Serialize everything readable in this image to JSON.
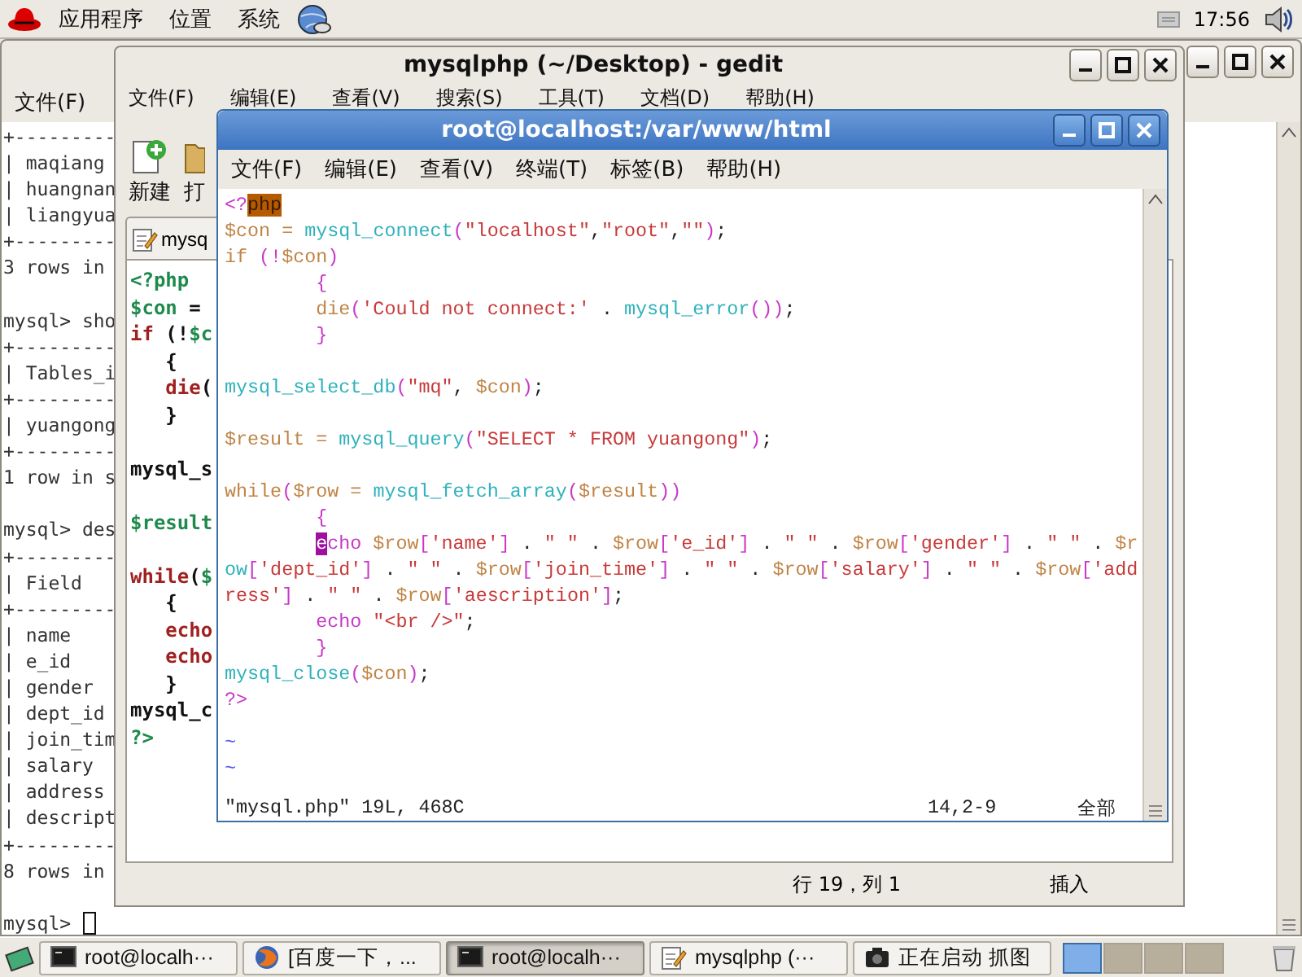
{
  "top_panel": {
    "menus": [
      "应用程序",
      "位置",
      "系统"
    ],
    "clock": "17:56"
  },
  "back_terminal": {
    "menus": [
      "文件(F)"
    ],
    "blocks": [
      [
        "+---------",
        "| maqiang",
        "| huangnan",
        "| liangyua",
        "+---------",
        "3 rows in"
      ],
      [
        "mysql> sho",
        "+---------",
        "| Tables_i",
        "+---------",
        "| yuangong",
        "+---------",
        "1 row in s"
      ],
      [
        "mysql> des",
        "+---------",
        "| Field",
        "+---------",
        "| name",
        "| e_id",
        "| gender",
        "| dept_id",
        "| join_tim",
        "| salary",
        "| address",
        "| descript",
        "+---------",
        "8 rows in"
      ]
    ],
    "prompt": "mysql>"
  },
  "gedit": {
    "title": "mysqlphp (~/Desktop) - gedit",
    "menus": [
      "文件(F)",
      "编辑(E)",
      "查看(V)",
      "搜索(S)",
      "工具(T)",
      "文档(D)",
      "帮助(H)"
    ],
    "toolbar": [
      {
        "kind": "new",
        "label": "新建"
      },
      {
        "kind": "open",
        "label": "打"
      }
    ],
    "tab": "mysq",
    "blocks": [
      [
        [
          {
            "kind": "variable",
            "text": "<?php"
          }
        ],
        [
          {
            "kind": "variable",
            "text": "$con"
          },
          {
            "kind": "text",
            "text": " ="
          }
        ],
        [
          {
            "kind": "keyword",
            "text": "if"
          },
          {
            "kind": "text",
            "text": " (!"
          },
          {
            "kind": "variable",
            "text": "$c"
          }
        ],
        [
          {
            "kind": "text",
            "text": "   {"
          }
        ],
        [
          {
            "kind": "keyword",
            "text": "   die"
          },
          {
            "kind": "text",
            "text": "("
          }
        ],
        [
          {
            "kind": "text",
            "text": "   }"
          }
        ]
      ],
      [
        [
          {
            "kind": "text",
            "text": "mysql_s"
          }
        ]
      ],
      [
        [
          {
            "kind": "variable",
            "text": "$result"
          }
        ]
      ],
      [
        [
          {
            "kind": "keyword",
            "text": "while"
          },
          {
            "kind": "text",
            "text": "("
          },
          {
            "kind": "variable",
            "text": "$"
          }
        ],
        [
          {
            "kind": "text",
            "text": "   {"
          }
        ],
        [
          {
            "kind": "keyword",
            "text": "   echo"
          }
        ],
        [
          {
            "kind": "keyword",
            "text": "   echo"
          }
        ],
        [
          {
            "kind": "text",
            "text": "   }"
          }
        ],
        [
          {
            "kind": "text",
            "text": "mysql_c"
          }
        ],
        [
          {
            "kind": "variable",
            "text": "?>"
          }
        ]
      ]
    ],
    "status": {
      "position": "行 19，列 1",
      "mode": "插入"
    }
  },
  "front_terminal": {
    "title": "root@localhost:/var/www/html",
    "menus": [
      "文件(F)",
      "编辑(E)",
      "查看(V)",
      "终端(T)",
      "标签(B)",
      "帮助(H)"
    ],
    "blocks": [
      [
        [
          {
            "kind": "tag",
            "text": "<?"
          },
          {
            "kind": "match",
            "text": "php"
          }
        ],
        [
          {
            "kind": "variable",
            "text": "$con = "
          },
          {
            "kind": "function",
            "text": "mysql_connect"
          },
          {
            "kind": "tag",
            "text": "("
          },
          {
            "kind": "string",
            "text": "\"localhost\""
          },
          {
            "kind": "text",
            "text": ","
          },
          {
            "kind": "string",
            "text": "\"root\""
          },
          {
            "kind": "text",
            "text": ","
          },
          {
            "kind": "string",
            "text": "\"\""
          },
          {
            "kind": "tag",
            "text": ")"
          },
          {
            "kind": "text",
            "text": ";"
          }
        ],
        [
          {
            "kind": "variable",
            "text": "if "
          },
          {
            "kind": "tag",
            "text": "(!"
          },
          {
            "kind": "variable",
            "text": "$con"
          },
          {
            "kind": "tag",
            "text": ")"
          }
        ],
        [
          {
            "kind": "tag",
            "text": "        {"
          }
        ],
        [
          {
            "kind": "variable",
            "text": "        die"
          },
          {
            "kind": "tag",
            "text": "("
          },
          {
            "kind": "string",
            "text": "'Could not connect:'"
          },
          {
            "kind": "text",
            "text": " . "
          },
          {
            "kind": "function",
            "text": "mysql_error"
          },
          {
            "kind": "tag",
            "text": "())"
          },
          {
            "kind": "text",
            "text": ";"
          }
        ],
        [
          {
            "kind": "tag",
            "text": "        }"
          }
        ]
      ],
      [
        [
          {
            "kind": "function",
            "text": "mysql_select_db"
          },
          {
            "kind": "tag",
            "text": "("
          },
          {
            "kind": "string",
            "text": "\"mq\""
          },
          {
            "kind": "text",
            "text": ", "
          },
          {
            "kind": "variable",
            "text": "$con"
          },
          {
            "kind": "tag",
            "text": ")"
          },
          {
            "kind": "text",
            "text": ";"
          }
        ]
      ],
      [
        [
          {
            "kind": "variable",
            "text": "$result = "
          },
          {
            "kind": "function",
            "text": "mysql_query"
          },
          {
            "kind": "tag",
            "text": "("
          },
          {
            "kind": "string",
            "text": "\"SELECT * FROM yuangong\""
          },
          {
            "kind": "tag",
            "text": ")"
          },
          {
            "kind": "text",
            "text": ";"
          }
        ]
      ],
      [
        [
          {
            "kind": "variable",
            "text": "while"
          },
          {
            "kind": "tag",
            "text": "("
          },
          {
            "kind": "variable",
            "text": "$row = "
          },
          {
            "kind": "function",
            "text": "mysql_fetch_array"
          },
          {
            "kind": "tag",
            "text": "("
          },
          {
            "kind": "variable",
            "text": "$result"
          },
          {
            "kind": "tag",
            "text": "))"
          }
        ],
        [
          {
            "kind": "tag",
            "text": "        {"
          }
        ],
        [
          {
            "kind": "cursor",
            "text": "e",
            "indent": true
          },
          {
            "kind": "tag",
            "text": "cho"
          },
          {
            "kind": "variable",
            "text": " $row"
          },
          {
            "kind": "tag",
            "text": "["
          },
          {
            "kind": "string",
            "text": "'name'"
          },
          {
            "kind": "tag",
            "text": "]"
          },
          {
            "kind": "text",
            "text": " . "
          },
          {
            "kind": "string",
            "text": "\" \""
          },
          {
            "kind": "text",
            "text": " . "
          },
          {
            "kind": "variable",
            "text": "$row"
          },
          {
            "kind": "tag",
            "text": "["
          },
          {
            "kind": "string",
            "text": "'e_id'"
          },
          {
            "kind": "tag",
            "text": "]"
          },
          {
            "kind": "text",
            "text": " . "
          },
          {
            "kind": "string",
            "text": "\" \""
          },
          {
            "kind": "text",
            "text": " . "
          },
          {
            "kind": "variable",
            "text": "$row"
          },
          {
            "kind": "tag",
            "text": "["
          },
          {
            "kind": "string",
            "text": "'gender'"
          },
          {
            "kind": "tag",
            "text": "]"
          },
          {
            "kind": "text",
            "text": " . "
          },
          {
            "kind": "string",
            "text": "\" \""
          },
          {
            "kind": "text",
            "text": " . "
          },
          {
            "kind": "variable",
            "text": "$r"
          }
        ],
        [
          {
            "kind": "function",
            "text": "ow"
          },
          {
            "kind": "tag",
            "text": "["
          },
          {
            "kind": "string",
            "text": "'dept_id'"
          },
          {
            "kind": "tag",
            "text": "]"
          },
          {
            "kind": "text",
            "text": " . "
          },
          {
            "kind": "string",
            "text": "\" \""
          },
          {
            "kind": "text",
            "text": " . "
          },
          {
            "kind": "variable",
            "text": "$row"
          },
          {
            "kind": "tag",
            "text": "["
          },
          {
            "kind": "string",
            "text": "'join_time'"
          },
          {
            "kind": "tag",
            "text": "]"
          },
          {
            "kind": "text",
            "text": " . "
          },
          {
            "kind": "string",
            "text": "\" \""
          },
          {
            "kind": "text",
            "text": " . "
          },
          {
            "kind": "variable",
            "text": "$row"
          },
          {
            "kind": "tag",
            "text": "["
          },
          {
            "kind": "string",
            "text": "'salary'"
          },
          {
            "kind": "tag",
            "text": "]"
          },
          {
            "kind": "text",
            "text": " . "
          },
          {
            "kind": "string",
            "text": "\" \""
          },
          {
            "kind": "text",
            "text": " . "
          },
          {
            "kind": "variable",
            "text": "$row"
          },
          {
            "kind": "tag",
            "text": "["
          },
          {
            "kind": "string",
            "text": "'add"
          }
        ],
        [
          {
            "kind": "string",
            "text": "ress'"
          },
          {
            "kind": "tag",
            "text": "]"
          },
          {
            "kind": "text",
            "text": " . "
          },
          {
            "kind": "string",
            "text": "\" \""
          },
          {
            "kind": "text",
            "text": " . "
          },
          {
            "kind": "variable",
            "text": "$row"
          },
          {
            "kind": "tag",
            "text": "["
          },
          {
            "kind": "string",
            "text": "'aescription'"
          },
          {
            "kind": "tag",
            "text": "]"
          },
          {
            "kind": "text",
            "text": ";"
          }
        ],
        [
          {
            "kind": "tag",
            "text": "        echo"
          },
          {
            "kind": "string",
            "text": " \"<br />\""
          },
          {
            "kind": "text",
            "text": ";"
          }
        ],
        [
          {
            "kind": "tag",
            "text": "        }"
          }
        ],
        [
          {
            "kind": "function",
            "text": "mysql_close"
          },
          {
            "kind": "tag",
            "text": "("
          },
          {
            "kind": "variable",
            "text": "$con"
          },
          {
            "kind": "tag",
            "text": ")"
          },
          {
            "kind": "text",
            "text": ";"
          }
        ],
        [
          {
            "kind": "tag",
            "text": "?>"
          }
        ]
      ]
    ],
    "tildes": [
      "~",
      "~"
    ],
    "status": {
      "file": "\"mysql.php\" 19L, 468C",
      "position": "14,2-9",
      "scroll": "全部"
    }
  },
  "taskbar": {
    "tasks": [
      {
        "kind": "terminal",
        "label": "root@localh···",
        "selected": false
      },
      {
        "kind": "browser",
        "label": "[百度一下，...",
        "selected": false
      },
      {
        "kind": "terminal",
        "label": "root@localh···",
        "selected": true
      },
      {
        "kind": "editor",
        "label": "mysqlphp (···",
        "selected": false
      },
      {
        "kind": "camera",
        "label": "正在启动 抓图",
        "selected": false
      }
    ],
    "workspaces": [
      {
        "selected": true
      },
      {
        "selected": false
      },
      {
        "selected": false
      },
      {
        "selected": false
      }
    ]
  }
}
